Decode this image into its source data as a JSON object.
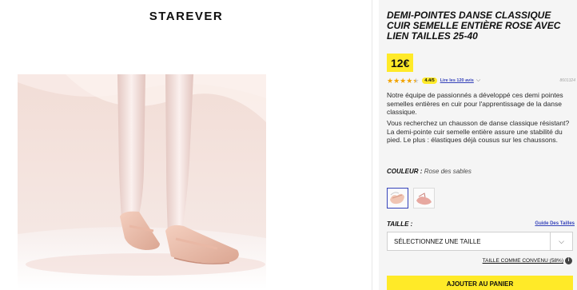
{
  "brand": "STAREVER",
  "product": {
    "title": "DEMI-POINTES DANSE CLASSIQUE CUIR SEMELLE ENTIÈRE ROSE AVEC LIEN TAILLES 25-40",
    "price": "12€",
    "rating": {
      "stars": 4.4,
      "badge": "4.4/5",
      "reviews_link": "Lire les 120 avis",
      "ref_code": "8601324"
    },
    "description": [
      "Notre équipe de passionnés a développé ces demi pointes semelles entières en cuir pour l'apprentissage de la danse classique.",
      "Vous recherchez un chausson de danse classique résistant? La demi-pointe cuir semelle entière assure une stabilité du pied. Le plus : élastiques déjà cousus sur les chaussons."
    ]
  },
  "color": {
    "label": "COULEUR :",
    "value": "Rose des sables"
  },
  "size": {
    "label": "TAILLE :",
    "guide_link": "Guide Des Tailles",
    "select_value": "SÉLECTIONNEZ UNE TAILLE",
    "fit_text": "TAILLE COMME CONVENU (58%)",
    "fit_info_icon": "i"
  },
  "cart": {
    "add_label": "AJOUTER AU PANIER"
  },
  "icons": {
    "reviews_chevron": "chevron-down-icon",
    "select_chevron": "chevron-down-icon",
    "fit_info": "info-icon"
  },
  "colors": {
    "accent_yellow": "#ffea28",
    "link_blue": "#3643ba",
    "star": "#f2a300"
  }
}
